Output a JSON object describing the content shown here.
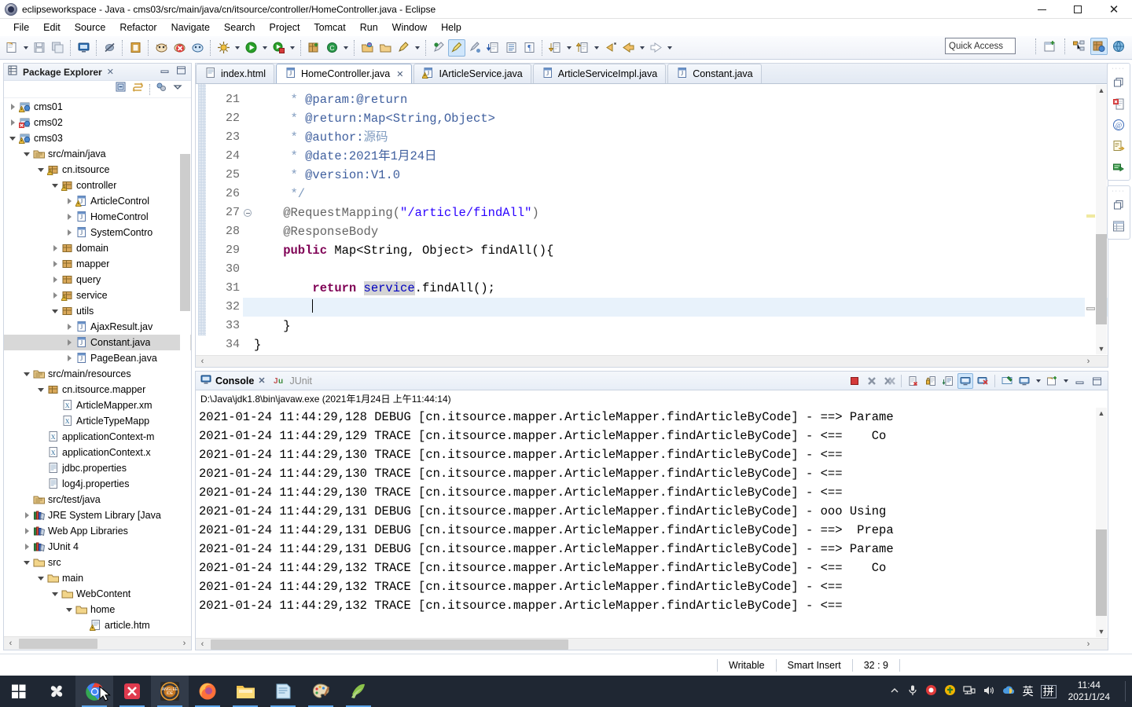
{
  "window": {
    "title": "eclipseworkspace - Java - cms03/src/main/java/cn/itsource/controller/HomeController.java - Eclipse",
    "logo_icon": "eclipse-logo-icon",
    "minimize_label": "–",
    "maximize_label": "❐",
    "close_label": "✕"
  },
  "menubar": {
    "items": [
      {
        "label": "File"
      },
      {
        "label": "Edit"
      },
      {
        "label": "Source"
      },
      {
        "label": "Refactor"
      },
      {
        "label": "Navigate"
      },
      {
        "label": "Search"
      },
      {
        "label": "Project"
      },
      {
        "label": "Tomcat"
      },
      {
        "label": "Run"
      },
      {
        "label": "Window"
      },
      {
        "label": "Help"
      }
    ]
  },
  "toolbar": {
    "quick_access_placeholder": "Quick Access",
    "items": [
      {
        "name": "new-wizard-icon",
        "glyph": "▭"
      },
      {
        "name": "new-dropdown-arrow",
        "glyph": "▾"
      },
      {
        "name": "save-icon",
        "glyph": "Ὃe"
      },
      {
        "name": "save-all-icon",
        "glyph": "⧉"
      },
      {
        "name": "sep1",
        "glyph": "|"
      },
      {
        "name": "console-icon",
        "glyph": "▣"
      },
      {
        "name": "sep2",
        "glyph": "|"
      },
      {
        "name": "skip-breakpoints-icon",
        "glyph": "⊘"
      },
      {
        "name": "sep3",
        "glyph": "|"
      },
      {
        "name": "clipboard-icon",
        "glyph": "Ὄb"
      },
      {
        "name": "sep4",
        "glyph": "|"
      },
      {
        "name": "tomcat-start-icon",
        "glyph": "ὃ1"
      },
      {
        "name": "tomcat-stop-icon",
        "glyph": "ὃ1"
      },
      {
        "name": "tomcat-restart-icon",
        "glyph": "ὃ1"
      },
      {
        "name": "sep5",
        "glyph": "|"
      },
      {
        "name": "debug-icon",
        "glyph": "☀"
      },
      {
        "name": "debug-dropdown-arrow",
        "glyph": "▾"
      },
      {
        "name": "run-icon",
        "glyph": "▶"
      },
      {
        "name": "run-dropdown-arrow",
        "glyph": "▾"
      },
      {
        "name": "run-external-tools-icon",
        "glyph": "▶"
      },
      {
        "name": "external-tools-dropdown-arrow",
        "glyph": "▾"
      },
      {
        "name": "sep6",
        "glyph": "|"
      },
      {
        "name": "new-package-icon",
        "glyph": "⊞"
      },
      {
        "name": "new-java-class-icon",
        "glyph": "Ⓒ"
      },
      {
        "name": "new-class-dropdown-arrow",
        "glyph": "▾"
      },
      {
        "name": "sep7",
        "glyph": "|"
      },
      {
        "name": "open-type-icon",
        "glyph": "Ὄ2"
      },
      {
        "name": "open-task-icon",
        "glyph": "Ὄ1"
      },
      {
        "name": "search-icon",
        "glyph": "὘c"
      },
      {
        "name": "search-dropdown-arrow",
        "glyph": "▾"
      },
      {
        "name": "sep8",
        "glyph": "|"
      },
      {
        "name": "toggle-mark-occurrences-icon",
        "glyph": "὘a"
      },
      {
        "name": "highlight-icon",
        "glyph": "✎"
      },
      {
        "name": "coverage-icon",
        "glyph": "●"
      },
      {
        "name": "next-annotation-icon",
        "glyph": "↓"
      },
      {
        "name": "show-whitespace-icon",
        "glyph": "▤"
      },
      {
        "name": "show-source-icon",
        "glyph": "¶"
      },
      {
        "name": "sep9",
        "glyph": "|"
      },
      {
        "name": "next-edit-icon",
        "glyph": "↓"
      },
      {
        "name": "next-edit-dropdown-arrow",
        "glyph": "▾"
      },
      {
        "name": "previous-edit-icon",
        "glyph": "↑"
      },
      {
        "name": "previous-edit-dropdown-arrow",
        "glyph": "▾"
      },
      {
        "name": "last-edit-location-icon",
        "glyph": "⭠"
      },
      {
        "name": "back-icon",
        "glyph": "⬅"
      },
      {
        "name": "back-dropdown-arrow",
        "glyph": "▾"
      },
      {
        "name": "forward-icon",
        "glyph": "➡"
      },
      {
        "name": "forward-dropdown-arrow",
        "glyph": "▾"
      }
    ],
    "perspective": [
      {
        "name": "open-perspective-icon"
      },
      {
        "name": "perspective-java-ee-icon"
      },
      {
        "name": "perspective-java-icon",
        "active": true
      },
      {
        "name": "perspective-web-icon"
      }
    ]
  },
  "package_explorer": {
    "title": "Package Explorer",
    "close_label": "✕",
    "minimize_label": "–",
    "maximize_label": "❐",
    "toolbar": [
      {
        "name": "collapse-all-icon"
      },
      {
        "name": "link-with-editor-icon"
      },
      {
        "name": "view-menu-filters-icon"
      },
      {
        "name": "view-menu-icon"
      }
    ],
    "tree": [
      {
        "label": "cms01",
        "depth": 1,
        "twist": "closed",
        "icon": "java-project-icon",
        "warning": true
      },
      {
        "label": "cms02",
        "depth": 1,
        "twist": "closed",
        "icon": "java-project-icon",
        "error": true
      },
      {
        "label": "cms03",
        "depth": 1,
        "twist": "open",
        "icon": "java-project-icon",
        "warning": true
      },
      {
        "label": "src/main/java",
        "depth": 2,
        "twist": "open",
        "icon": "source-folder-icon"
      },
      {
        "label": "cn.itsource",
        "depth": 3,
        "twist": "open",
        "icon": "package-icon",
        "warning": true
      },
      {
        "label": "controller",
        "depth": 4,
        "twist": "open",
        "icon": "package-icon",
        "warning": true
      },
      {
        "label": "ArticleControl",
        "depth": 5,
        "twist": "closed",
        "icon": "java-file-icon",
        "warning": true
      },
      {
        "label": "HomeControl",
        "depth": 5,
        "twist": "closed",
        "icon": "java-file-icon"
      },
      {
        "label": "SystemContro",
        "depth": 5,
        "twist": "closed",
        "icon": "java-file-icon"
      },
      {
        "label": "domain",
        "depth": 4,
        "twist": "closed",
        "icon": "package-icon"
      },
      {
        "label": "mapper",
        "depth": 4,
        "twist": "closed",
        "icon": "package-icon"
      },
      {
        "label": "query",
        "depth": 4,
        "twist": "closed",
        "icon": "package-icon"
      },
      {
        "label": "service",
        "depth": 4,
        "twist": "closed",
        "icon": "package-icon",
        "warning": true
      },
      {
        "label": "utils",
        "depth": 4,
        "twist": "open",
        "icon": "package-icon"
      },
      {
        "label": "AjaxResult.jav",
        "depth": 5,
        "twist": "closed",
        "icon": "java-file-icon"
      },
      {
        "label": "Constant.java",
        "depth": 5,
        "twist": "closed",
        "icon": "java-file-icon",
        "selected": true
      },
      {
        "label": "PageBean.java",
        "depth": 5,
        "twist": "closed",
        "icon": "java-file-icon"
      },
      {
        "label": "src/main/resources",
        "depth": 2,
        "twist": "open",
        "icon": "source-folder-icon"
      },
      {
        "label": "cn.itsource.mapper",
        "depth": 3,
        "twist": "open",
        "icon": "package-icon"
      },
      {
        "label": "ArticleMapper.xm",
        "depth": 4,
        "twist": "none",
        "icon": "xml-file-icon"
      },
      {
        "label": "ArticleTypeMapp",
        "depth": 4,
        "twist": "none",
        "icon": "xml-file-icon"
      },
      {
        "label": "applicationContext-m",
        "depth": 3,
        "twist": "none",
        "icon": "xml-file-icon"
      },
      {
        "label": "applicationContext.x",
        "depth": 3,
        "twist": "none",
        "icon": "xml-file-icon"
      },
      {
        "label": "jdbc.properties",
        "depth": 3,
        "twist": "none",
        "icon": "properties-file-icon"
      },
      {
        "label": "log4j.properties",
        "depth": 3,
        "twist": "none",
        "icon": "properties-file-icon"
      },
      {
        "label": "src/test/java",
        "depth": 2,
        "twist": "none",
        "icon": "source-folder-icon"
      },
      {
        "label": "JRE System Library [Java",
        "depth": 2,
        "twist": "closed",
        "icon": "library-icon"
      },
      {
        "label": "Web App Libraries",
        "depth": 2,
        "twist": "closed",
        "icon": "library-icon"
      },
      {
        "label": "JUnit 4",
        "depth": 2,
        "twist": "closed",
        "icon": "library-icon"
      },
      {
        "label": "src",
        "depth": 2,
        "twist": "open",
        "icon": "folder-icon"
      },
      {
        "label": "main",
        "depth": 3,
        "twist": "open",
        "icon": "folder-icon"
      },
      {
        "label": "WebContent",
        "depth": 4,
        "twist": "open",
        "icon": "folder-icon"
      },
      {
        "label": "home",
        "depth": 5,
        "twist": "open",
        "icon": "folder-icon"
      },
      {
        "label": "article.htm",
        "depth": 6,
        "twist": "none",
        "icon": "html-file-icon",
        "warning": true
      }
    ],
    "hscroll_left": "‹",
    "hscroll_right": "›"
  },
  "editor": {
    "tabs": [
      {
        "label": "index.html",
        "icon": "html-file-icon",
        "active": false,
        "closable": false
      },
      {
        "label": "HomeController.java",
        "icon": "java-file-icon",
        "active": true,
        "closable": true,
        "close_label": "✕"
      },
      {
        "label": "IArticleService.java",
        "icon": "java-file-icon",
        "active": false,
        "warning": true,
        "closable": false
      },
      {
        "label": "ArticleServiceImpl.java",
        "icon": "java-file-icon",
        "active": false,
        "closable": false
      },
      {
        "label": "Constant.java",
        "icon": "java-file-icon",
        "active": false,
        "closable": false
      }
    ],
    "lines": [
      {
        "no": 21,
        "fold": false,
        "current": false,
        "tokens": [
          {
            "t": "     * ",
            "c": "tok-cmt-dim"
          },
          {
            "t": "@param:@return",
            "c": "tok-cmt"
          }
        ]
      },
      {
        "no": 22,
        "fold": false,
        "current": false,
        "tokens": [
          {
            "t": "     * ",
            "c": "tok-cmt-dim"
          },
          {
            "t": "@return:Map<String,Object>",
            "c": "tok-cmt"
          }
        ]
      },
      {
        "no": 23,
        "fold": false,
        "current": false,
        "tokens": [
          {
            "t": "     * ",
            "c": "tok-cmt-dim"
          },
          {
            "t": "@author:",
            "c": "tok-cmt"
          },
          {
            "t": "源码",
            "c": "tok-cmt-dim"
          }
        ]
      },
      {
        "no": 24,
        "fold": false,
        "current": false,
        "tokens": [
          {
            "t": "     * ",
            "c": "tok-cmt-dim"
          },
          {
            "t": "@date:2021年1月24日",
            "c": "tok-cmt"
          }
        ]
      },
      {
        "no": 25,
        "fold": false,
        "current": false,
        "tokens": [
          {
            "t": "     * ",
            "c": "tok-cmt-dim"
          },
          {
            "t": "@version:V1.0",
            "c": "tok-cmt"
          }
        ]
      },
      {
        "no": 26,
        "fold": false,
        "current": false,
        "tokens": [
          {
            "t": "     */",
            "c": "tok-cmt-dim"
          }
        ]
      },
      {
        "no": 27,
        "fold": true,
        "current": false,
        "tokens": [
          {
            "t": "    @RequestMapping(",
            "c": "tok-ann"
          },
          {
            "t": "\"/article/findAll\"",
            "c": "tok-str"
          },
          {
            "t": ")",
            "c": "tok-ann"
          }
        ]
      },
      {
        "no": 28,
        "fold": false,
        "current": false,
        "tokens": [
          {
            "t": "    @ResponseBody",
            "c": "tok-ann"
          }
        ]
      },
      {
        "no": 29,
        "fold": false,
        "current": false,
        "tokens": [
          {
            "t": "    public ",
            "c": "tok-kw"
          },
          {
            "t": "Map<String, Object> findAll(){",
            "c": "tok-plain"
          }
        ]
      },
      {
        "no": 30,
        "fold": false,
        "current": false,
        "tokens": [
          {
            "t": "",
            "c": "tok-plain"
          }
        ]
      },
      {
        "no": 31,
        "fold": false,
        "current": false,
        "tokens": [
          {
            "t": "        return ",
            "c": "tok-kw"
          },
          {
            "t": "service",
            "c": "tok-field"
          },
          {
            "t": ".findAll();",
            "c": "tok-plain"
          }
        ]
      },
      {
        "no": 32,
        "fold": false,
        "current": true,
        "caret": true,
        "tokens": [
          {
            "t": "        ",
            "c": "tok-plain"
          }
        ]
      },
      {
        "no": 33,
        "fold": false,
        "current": false,
        "tokens": [
          {
            "t": "    }",
            "c": "tok-plain"
          }
        ]
      },
      {
        "no": 34,
        "fold": false,
        "current": false,
        "tokens": [
          {
            "t": "}",
            "c": "tok-plain"
          }
        ]
      }
    ],
    "scroll_up": "▲",
    "scroll_down": "▼",
    "hscroll_left": "‹",
    "hscroll_right": "›"
  },
  "console": {
    "tabs": [
      {
        "label": "Console",
        "icon": "console-icon",
        "active": true,
        "close_label": "✕"
      },
      {
        "label": "JUnit",
        "icon": "junit-icon",
        "active": false
      }
    ],
    "command_line": "D:\\Java\\jdk1.8\\bin\\javaw.exe (2021年1月24日 上午11:44:14)",
    "tools": [
      {
        "name": "terminate-icon"
      },
      {
        "name": "remove-launch-icon"
      },
      {
        "name": "remove-all-terminated-icon"
      },
      {
        "name": "sep1"
      },
      {
        "name": "clear-console-icon"
      },
      {
        "name": "scroll-lock-icon"
      },
      {
        "name": "word-wrap-icon"
      },
      {
        "name": "show-console-on-output-icon",
        "active": true
      },
      {
        "name": "show-console-on-error-icon"
      },
      {
        "name": "sep2"
      },
      {
        "name": "pin-console-icon"
      },
      {
        "name": "display-selected-console-icon"
      },
      {
        "name": "display-console-dropdown-arrow"
      },
      {
        "name": "open-console-icon"
      },
      {
        "name": "open-console-dropdown-arrow"
      },
      {
        "name": "minimize-icon"
      },
      {
        "name": "maximize-icon"
      }
    ],
    "log_lines": [
      "2021-01-24 11:44:29,128 DEBUG [cn.itsource.mapper.ArticleMapper.findArticleByCode] - ==> Parame",
      "2021-01-24 11:44:29,129 TRACE [cn.itsource.mapper.ArticleMapper.findArticleByCode] - <==    Co",
      "2021-01-24 11:44:29,130 TRACE [cn.itsource.mapper.ArticleMapper.findArticleByCode] - <==",
      "2021-01-24 11:44:29,130 TRACE [cn.itsource.mapper.ArticleMapper.findArticleByCode] - <==",
      "2021-01-24 11:44:29,130 TRACE [cn.itsource.mapper.ArticleMapper.findArticleByCode] - <==",
      "2021-01-24 11:44:29,131 DEBUG [cn.itsource.mapper.ArticleMapper.findArticleByCode] - ooo Using",
      "2021-01-24 11:44:29,131 DEBUG [cn.itsource.mapper.ArticleMapper.findArticleByCode] - ==>  Prepa",
      "2021-01-24 11:44:29,131 DEBUG [cn.itsource.mapper.ArticleMapper.findArticleByCode] - ==> Parame",
      "2021-01-24 11:44:29,132 TRACE [cn.itsource.mapper.ArticleMapper.findArticleByCode] - <==    Co",
      "2021-01-24 11:44:29,132 TRACE [cn.itsource.mapper.ArticleMapper.findArticleByCode] - <==",
      "2021-01-24 11:44:29,132 TRACE [cn.itsource.mapper.ArticleMapper.findArticleByCode] - <=="
    ],
    "scroll_up": "▲",
    "scroll_down": "▼",
    "hscroll_left": "‹",
    "hscroll_right": "›"
  },
  "fastview": {
    "groups": [
      {
        "items": [
          {
            "name": "restore-icon"
          },
          {
            "name": "problems-view-icon"
          },
          {
            "name": "javadoc-view-icon"
          },
          {
            "name": "declaration-view-icon"
          },
          {
            "name": "servers-view-icon"
          }
        ]
      },
      {
        "items": [
          {
            "name": "restore-icon"
          },
          {
            "name": "outline-view-icon"
          }
        ]
      }
    ]
  },
  "statusbar": {
    "writable": "Writable",
    "insert_mode": "Smart Insert",
    "position": "32 : 9"
  },
  "taskbar": {
    "start_label": "start-button",
    "apps": [
      {
        "name": "taskbar-windows-start",
        "icon": "windows-logo-icon"
      },
      {
        "name": "taskbar-app-fan",
        "icon": "fan-icon"
      },
      {
        "name": "taskbar-app-chrome",
        "icon": "chrome-icon",
        "active": true,
        "running": true
      },
      {
        "name": "taskbar-app-xmind",
        "icon": "xmind-icon",
        "running": true
      },
      {
        "name": "taskbar-app-eclipse",
        "icon": "eclipse-ide-icon",
        "active": true,
        "running": true
      },
      {
        "name": "taskbar-app-firefox",
        "icon": "firefox-icon",
        "running": true
      },
      {
        "name": "taskbar-app-explorer",
        "icon": "file-explorer-icon",
        "running": true
      },
      {
        "name": "taskbar-app-notepad",
        "icon": "notepad-icon",
        "running": true
      },
      {
        "name": "taskbar-app-paint",
        "icon": "paint-icon",
        "running": true
      },
      {
        "name": "taskbar-app-navicat",
        "icon": "navicat-icon",
        "running": true
      }
    ],
    "tray": [
      {
        "name": "show-hidden-icons-chevron",
        "glyph": "∧"
      },
      {
        "name": "microphone-icon",
        "glyph": "Ἲ4"
      },
      {
        "name": "recording-icon",
        "glyph": "⏺"
      },
      {
        "name": "update-icon",
        "glyph": "⬆"
      },
      {
        "name": "network-icon",
        "glyph": "὚7"
      },
      {
        "name": "volume-icon",
        "glyph": "ὐa"
      },
      {
        "name": "cloud-icon",
        "glyph": "☁"
      },
      {
        "name": "ime-language-icon",
        "glyph": "英"
      },
      {
        "name": "ime-pinyin-icon",
        "glyph": "拼"
      }
    ],
    "clock_time": "11:44",
    "clock_date": "2021/1/24"
  },
  "colors": {
    "accent": "#3f5f9e",
    "keyword": "#7f0055",
    "string": "#2a00ff",
    "field": "#0000c0",
    "selection": "#d8d8d8",
    "current_line": "#e8f2fb",
    "taskbar_bg": "#1f2733"
  }
}
